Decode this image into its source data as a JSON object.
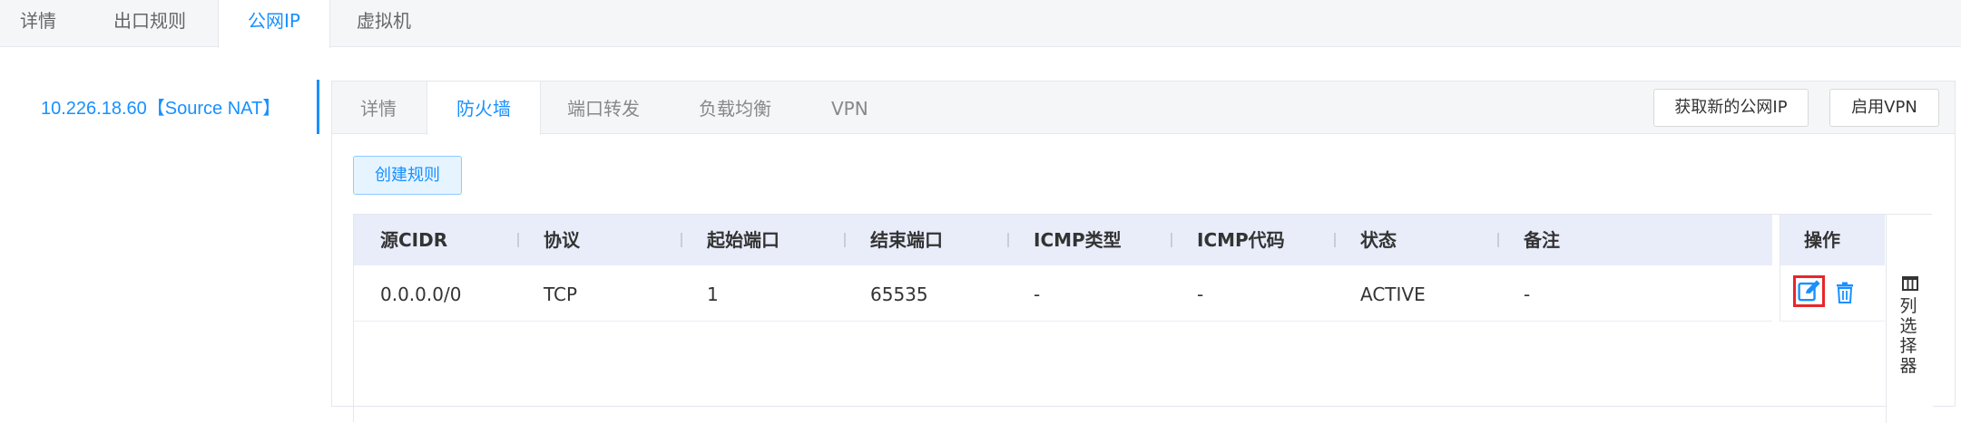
{
  "top_tabs": [
    {
      "label": "详情"
    },
    {
      "label": "出口规则"
    },
    {
      "label": "公网IP",
      "active": true
    },
    {
      "label": "虚拟机"
    }
  ],
  "ip_list": [
    {
      "label": "10.226.18.60【Source NAT】",
      "selected": true
    }
  ],
  "sub_tabs": [
    {
      "label": "详情"
    },
    {
      "label": "防火墙",
      "active": true
    },
    {
      "label": "端口转发"
    },
    {
      "label": "负载均衡"
    },
    {
      "label": "VPN"
    }
  ],
  "actions": {
    "acquire_ip": "获取新的公网IP",
    "enable_vpn": "启用VPN"
  },
  "create_rule": "创建规则",
  "table": {
    "columns": [
      "源CIDR",
      "协议",
      "起始端口",
      "结束端口",
      "ICMP类型",
      "ICMP代码",
      "状态",
      "备注"
    ],
    "operation_header": "操作",
    "rows": [
      [
        "0.0.0.0/0",
        "TCP",
        "1",
        "65535",
        "-",
        "-",
        "ACTIVE",
        "-"
      ]
    ]
  },
  "column_picker": "列选择器",
  "icons": [
    "edit-icon",
    "trash-icon",
    "columns-icon"
  ],
  "colors": {
    "accent": "#1890ff",
    "highlight": "#e8262a",
    "header_bg": "#e9edfa"
  }
}
